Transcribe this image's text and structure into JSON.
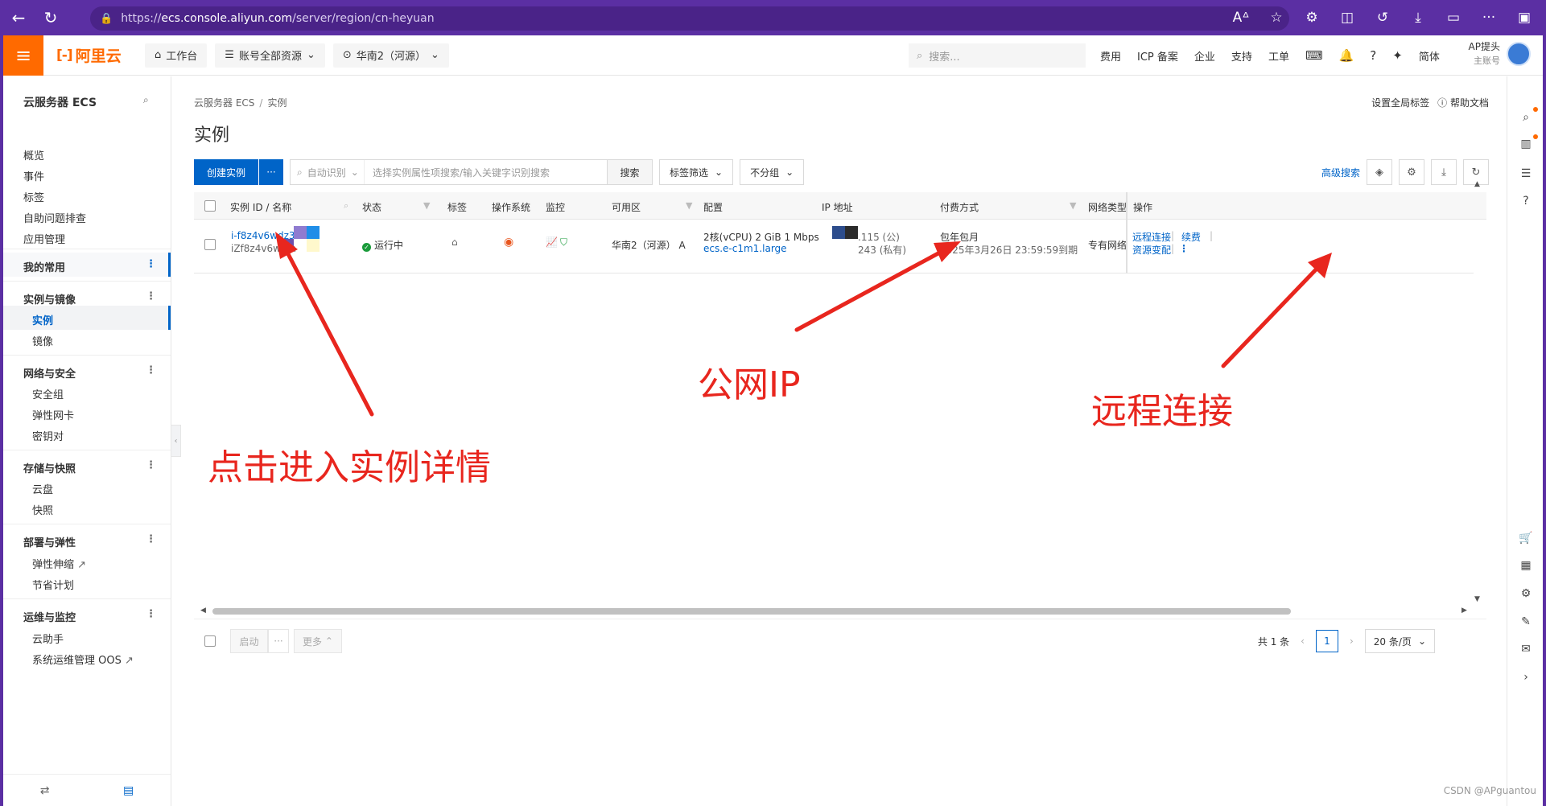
{
  "browser": {
    "url_scheme": "https://",
    "url_host": "ecs.console.aliyun.com",
    "url_path": "/server/region/cn-heyuan"
  },
  "topbar": {
    "logo_text": "阿里云",
    "logo_mark": "[-]",
    "workbench": "工作台",
    "resources": "账号全部资源",
    "region": "华南2（河源）",
    "search_placeholder": "搜索...",
    "links": [
      "费用",
      "ICP 备案",
      "企业",
      "支持",
      "工单"
    ],
    "lang": "简体",
    "account_name": "AP提头",
    "account_role": "主账号"
  },
  "sidebar": {
    "title": "云服务器 ECS",
    "top_items": [
      "概览",
      "事件",
      "标签",
      "自助问题排查",
      "应用管理"
    ],
    "favorites": "我的常用",
    "groups": [
      {
        "name": "实例与镜像",
        "items": [
          "实例",
          "镜像"
        ]
      },
      {
        "name": "网络与安全",
        "items": [
          "安全组",
          "弹性网卡",
          "密钥对"
        ]
      },
      {
        "name": "存储与快照",
        "items": [
          "云盘",
          "快照"
        ]
      },
      {
        "name": "部署与弹性",
        "items": [
          "弹性伸缩",
          "节省计划"
        ]
      },
      {
        "name": "运维与监控",
        "items": [
          "云助手",
          "系统运维管理 OOS"
        ]
      }
    ]
  },
  "main": {
    "breadcrumb": [
      "云服务器 ECS",
      "实例"
    ],
    "title": "实例",
    "global_tag": "设置全局标签",
    "help_doc": "帮助文档",
    "create_btn": "创建实例",
    "more_btn": "···",
    "search_mode": "自动识别",
    "search_placeholder": "选择实例属性项搜索/输入关键字识别搜索",
    "search_btn": "搜索",
    "tag_filter": "标签筛选",
    "group_by": "不分组",
    "adv_search": "高级搜索"
  },
  "table": {
    "headers": [
      "实例 ID / 名称",
      "状态",
      "标签",
      "操作系统",
      "监控",
      "可用区",
      "配置",
      "IP 地址",
      "付费方式",
      "网络类型",
      "操作"
    ],
    "row": {
      "instance_id": "i-f8z4v6wdz3n",
      "instance_name": "iZf8z4v6w   3n",
      "status": "运行中",
      "zone": "华南2（河源） A",
      "config_spec": "2核(vCPU)   2 GiB   1 Mbps",
      "config_type": "ecs.e-c1m1.large",
      "public_ip": ".115 (公)",
      "private_ip": "243 (私有)",
      "billing": "包年包月",
      "expire": "2025年3月26日 23:59:59到期",
      "network": "专有网络",
      "op_remote": "远程连接",
      "op_renew": "续费",
      "op_change": "资源变配"
    }
  },
  "footer": {
    "start_btn": "启动",
    "more_dots": "···",
    "more_btn": "更多",
    "total": "共 1 条",
    "current_page": "1",
    "page_size": "20 条/页"
  },
  "annotations": {
    "detail": "点击进入实例详情",
    "public_ip": "公网IP",
    "remote": "远程连接"
  },
  "watermark": "CSDN @APguantou",
  "colors": {
    "brand": "#ff6a00",
    "primary": "#0064c8",
    "annotation": "#e8261e",
    "running": "#1a9b3b"
  }
}
